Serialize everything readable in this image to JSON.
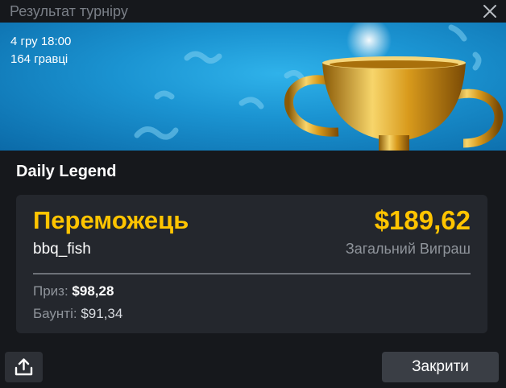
{
  "dialog": {
    "title": "Результат турніру"
  },
  "banner": {
    "date_time": "4 гру 18:00",
    "players": "164 гравці"
  },
  "tournament": {
    "name": "Daily Legend"
  },
  "result": {
    "winner_label": "Переможець",
    "winner_name": "bbq_fish",
    "total_amount": "$189,62",
    "total_label": "Загальний Виграш",
    "prize_label": "Приз: ",
    "prize_value": "$98,28",
    "bounty_label": "Баунті: ",
    "bounty_value": "$91,34"
  },
  "actions": {
    "close_label": "Закрити"
  },
  "icons": {
    "close": "close-icon",
    "share": "share-icon",
    "trophy": "trophy-icon"
  },
  "colors": {
    "accent": "#ffc400",
    "background": "#16181c",
    "card": "#24272d",
    "banner": "#1b94d2"
  }
}
